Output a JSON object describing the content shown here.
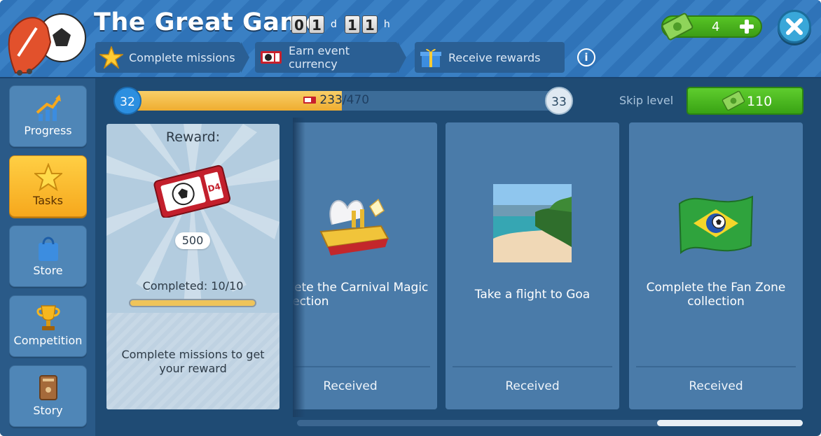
{
  "header": {
    "title": "The Great Game",
    "timer": {
      "d1": "0",
      "d2": "1",
      "day_unit": "d",
      "h1": "1",
      "h2": "1",
      "hour_unit": "h"
    },
    "steps": [
      {
        "label": "Complete missions",
        "icon": "star-icon"
      },
      {
        "label": "Earn event currency",
        "icon": "ticket-icon"
      },
      {
        "label": "Receive rewards",
        "icon": "gift-icon"
      }
    ],
    "info_icon": "i",
    "currency": {
      "value": "4",
      "icon": "cash-icon"
    }
  },
  "sidebar": {
    "items": [
      {
        "label": "Progress",
        "icon": "chart-arrow-icon"
      },
      {
        "label": "Tasks",
        "icon": "star-icon",
        "active": true
      },
      {
        "label": "Store",
        "icon": "shopping-bag-icon"
      },
      {
        "label": "Competition",
        "icon": "trophy-icon"
      },
      {
        "label": "Story",
        "icon": "book-icon"
      }
    ]
  },
  "progress": {
    "current_level": "32",
    "next_level": "33",
    "value": "233",
    "total": "/470",
    "fraction": 0.496,
    "skip_label": "Skip level",
    "skip_cost": "110"
  },
  "reward": {
    "heading": "Reward:",
    "amount": "500",
    "ticket_label": "D4",
    "completed": "Completed: 10/10",
    "completed_fraction": 1.0,
    "message": "Complete missions to get your reward"
  },
  "missions": [
    {
      "name": "mplete the Carnival Magic collection",
      "status": "Received",
      "image": "carnival-float-image"
    },
    {
      "name": "Take a flight to Goa",
      "status": "Received",
      "image": "goa-beach-image"
    },
    {
      "name": "Complete the Fan Zone collection",
      "status": "Received",
      "image": "brazil-flag-image"
    }
  ],
  "colors": {
    "header_blue": "#2f73b8",
    "active_tab": "#f6a81d",
    "progress_fill": "#efad30",
    "green_button": "#39a314",
    "card_blue": "#4a7ba9"
  }
}
